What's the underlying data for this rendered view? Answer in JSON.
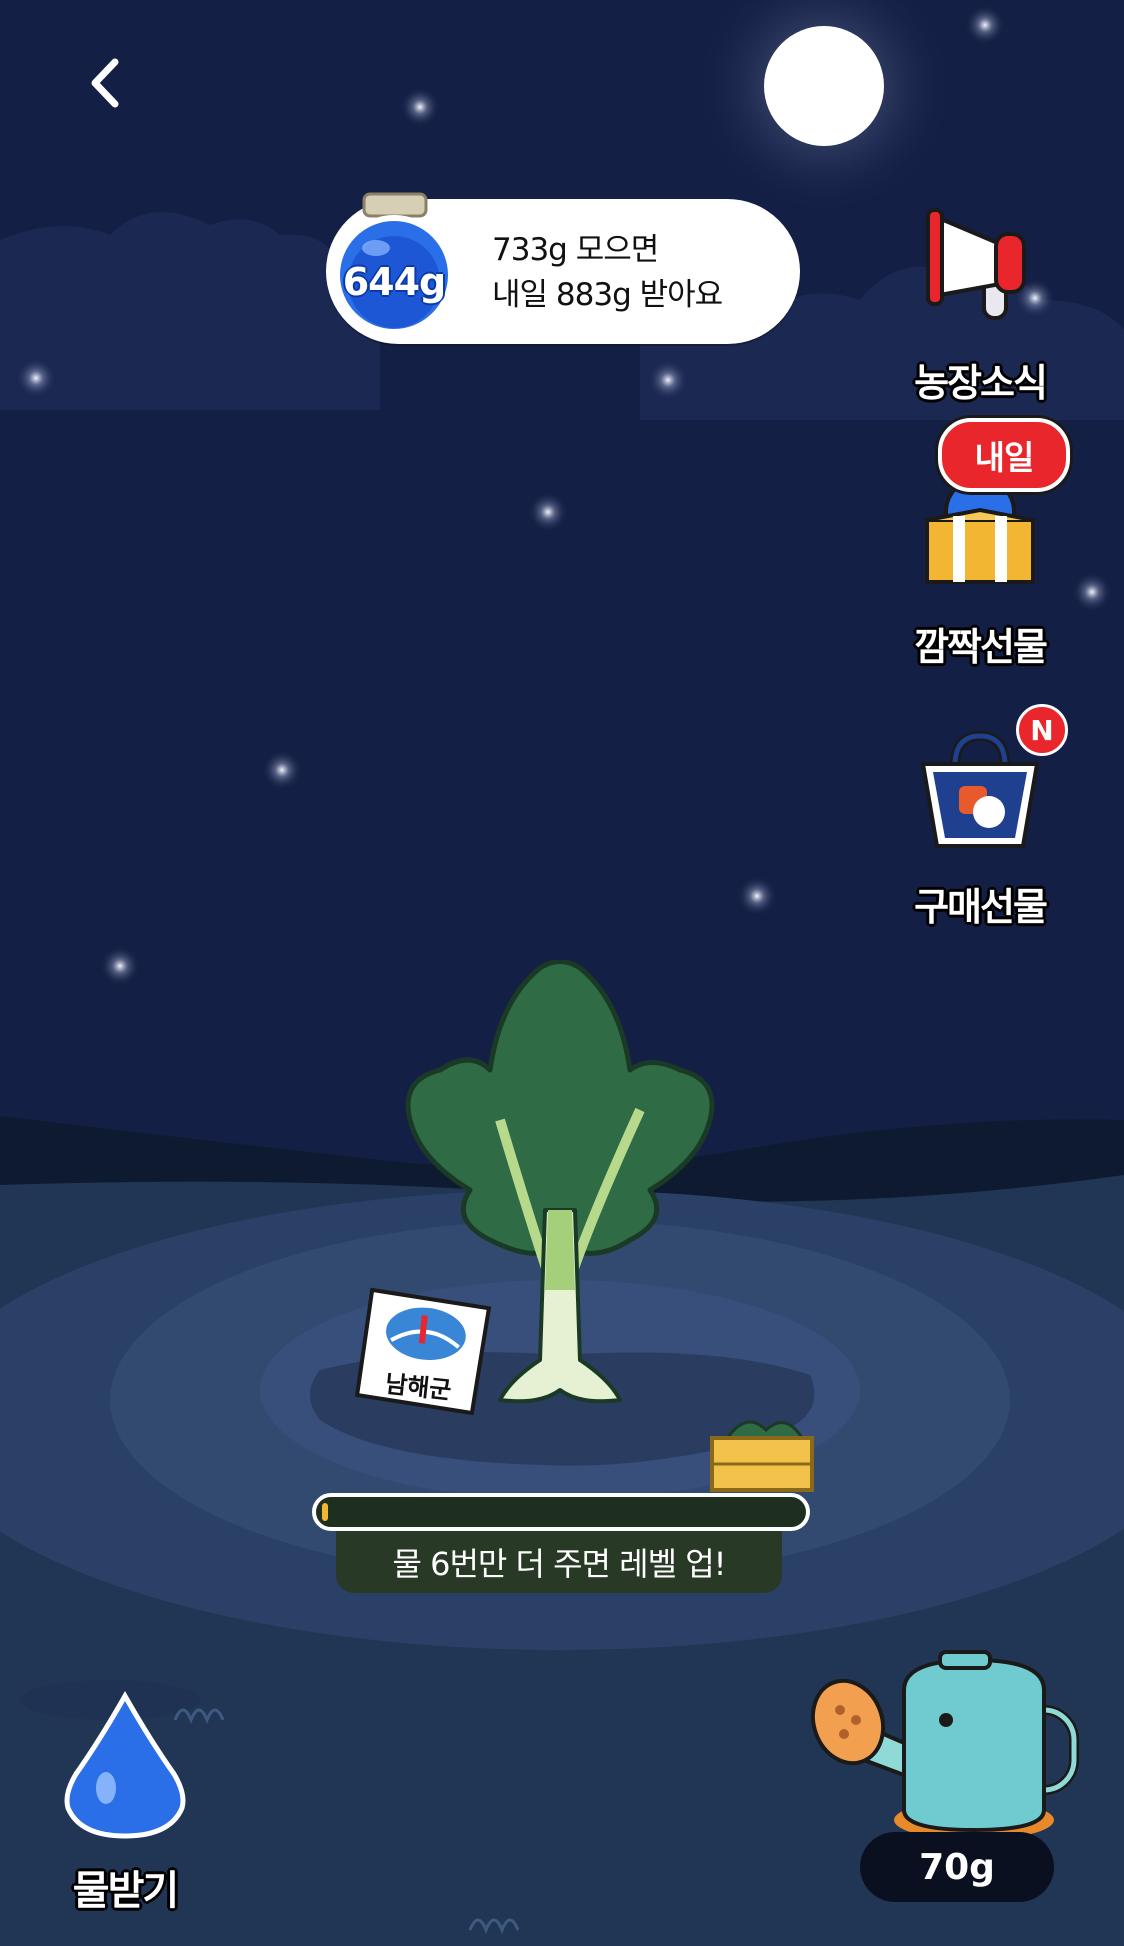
{
  "header": {
    "back_icon": "chevron-left-icon"
  },
  "water_status": {
    "current_amount": "644g",
    "line1": "733g 모으면",
    "line2": "내일 883g 받아요"
  },
  "side_menu": {
    "farm_news": {
      "label": "농장소식",
      "icon": "megaphone-icon"
    },
    "surprise_gift": {
      "label": "깜짝선물",
      "icon": "gift-box-icon",
      "badge": "내일"
    },
    "purchase_gift": {
      "label": "구매선물",
      "icon": "shopping-bag-icon",
      "badge": "N"
    }
  },
  "plant": {
    "sign_label": "남해군",
    "crop_icon": "spinach-icon",
    "crate_icon": "vegetable-crate-icon"
  },
  "level": {
    "progress_fraction": 0.01,
    "caption": "물 6번만 더 주면 레벨 업!"
  },
  "bottom": {
    "collect_water_label": "물받기",
    "collect_water_icon": "water-drop-icon",
    "watering_can_icon": "watering-can-icon",
    "watering_amount": "70g"
  },
  "colors": {
    "sky": "#141f45",
    "ground": "#233a5e",
    "leaf": "#2f6b45",
    "accent_red": "#e8262b",
    "progress": "#f2b632"
  }
}
